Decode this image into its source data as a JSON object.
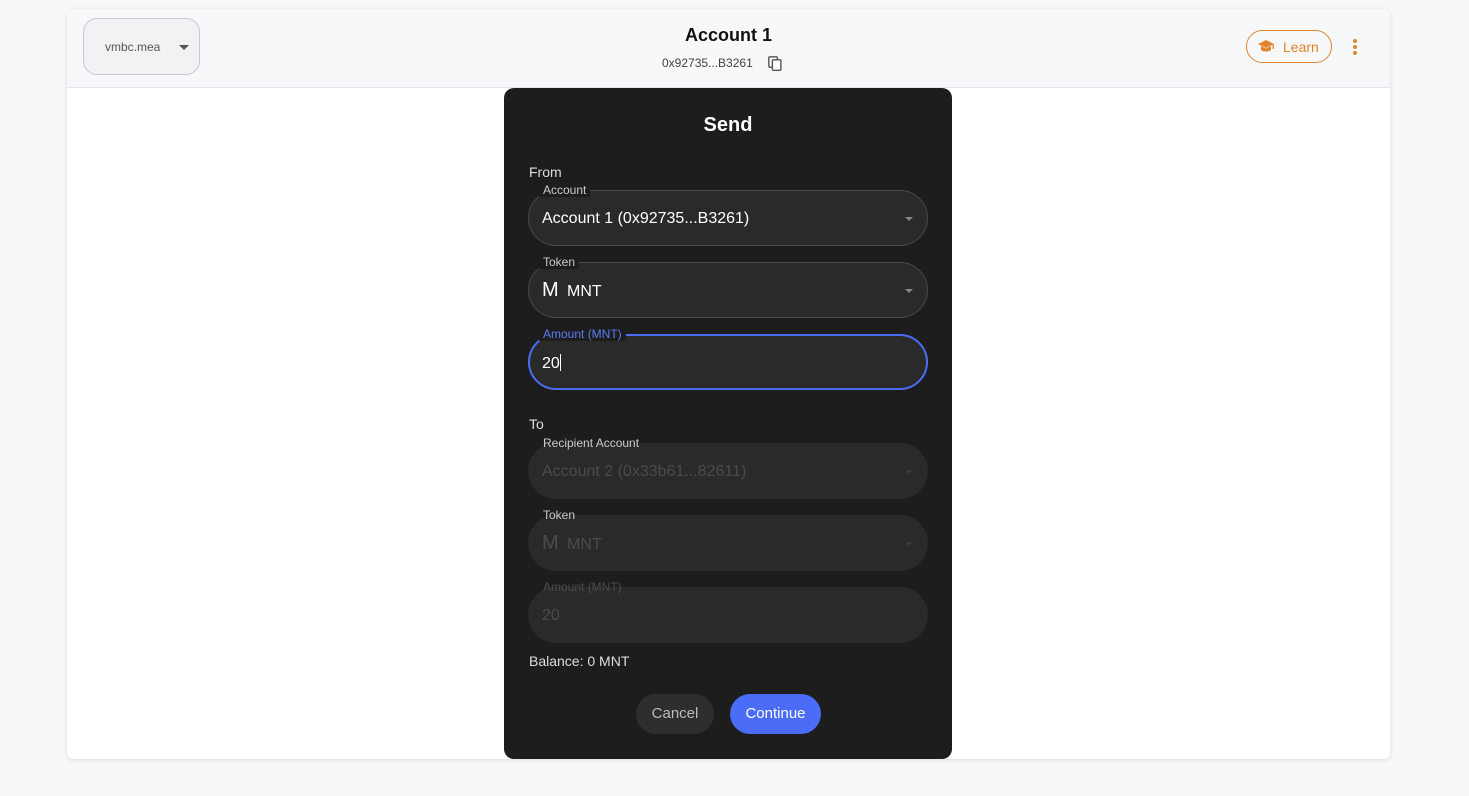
{
  "header": {
    "network": "vmbc.mea",
    "account_title": "Account 1",
    "account_address": "0x92735...B3261",
    "learn_label": "Learn",
    "accent_color": "#e0852b"
  },
  "modal": {
    "title": "Send",
    "from_label": "From",
    "from_account_label": "Account",
    "from_account_value": "Account 1 (0x92735...B3261)",
    "from_token_label": "Token",
    "from_token_symbol_icon": "M",
    "from_token_value": "MNT",
    "amount_label": "Amount (MNT)",
    "amount_value": "20",
    "to_label": "To",
    "recipient_label": "Recipient Account",
    "recipient_value": "Account 2 (0x33b61...82611)",
    "to_token_label": "Token",
    "to_token_symbol_icon": "M",
    "to_token_value": "MNT",
    "to_amount_label": "Amount (MNT)",
    "to_amount_value": "20",
    "balance": "Balance: 0 MNT",
    "cancel_label": "Cancel",
    "continue_label": "Continue",
    "primary_color": "#4a6cf7"
  }
}
